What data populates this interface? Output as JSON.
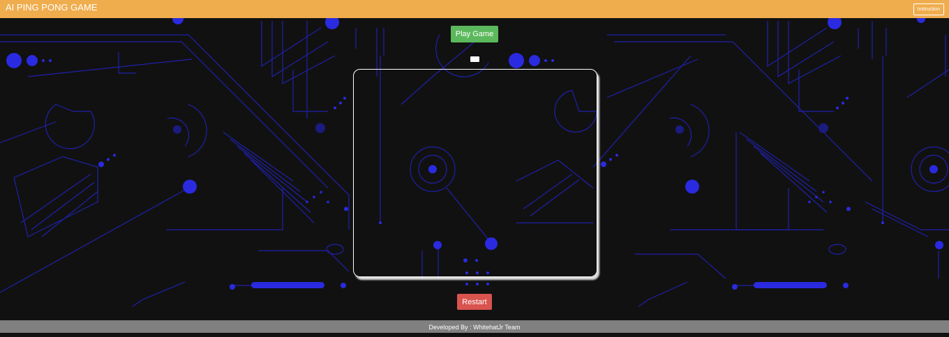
{
  "header": {
    "title": "AI PING PONG GAME",
    "instruction_label": "Instruction"
  },
  "controls": {
    "play_label": "Play Game",
    "restart_label": "Restart"
  },
  "footer": {
    "credit": "Developed By : WhitehatJr Team"
  },
  "colors": {
    "header_bg": "#f0ad4e",
    "play_button": "#5cb85c",
    "restart_button": "#d9534f",
    "footer_bg": "#808080",
    "background": "#111111",
    "circuit_lines": "#2a2ad8"
  }
}
